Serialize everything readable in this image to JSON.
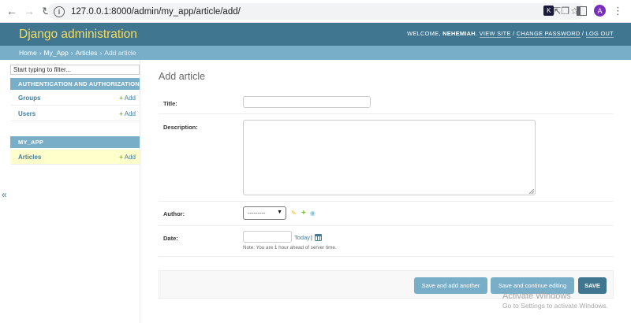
{
  "browser": {
    "url": "127.0.0.1:8000/admin/my_app/article/add/",
    "avatar_letter": "A",
    "ext_letter": "K"
  },
  "header": {
    "brand": "Django administration",
    "welcome": "WELCOME,",
    "username": "NEHEMIAH",
    "view_site": "VIEW SITE",
    "change_password": "CHANGE PASSWORD",
    "log_out": "LOG OUT",
    "separator": "/"
  },
  "breadcrumbs": {
    "items": [
      "Home",
      "My_App",
      "Articles"
    ],
    "current": "Add article",
    "sep": "›"
  },
  "sidebar": {
    "filter_placeholder": "Start typing to filter...",
    "collapse_glyph": "«",
    "apps": [
      {
        "caption": "AUTHENTICATION AND AUTHORIZATION",
        "models": [
          {
            "name": "Groups",
            "add": "Add"
          },
          {
            "name": "Users",
            "add": "Add"
          }
        ]
      },
      {
        "caption": "MY_APP",
        "models": [
          {
            "name": "Articles",
            "add": "Add"
          }
        ]
      }
    ]
  },
  "main": {
    "title": "Add article",
    "fields": {
      "title_label": "Title:",
      "description_label": "Description:",
      "author_label": "Author:",
      "author_selected": "---------",
      "date_label": "Date:",
      "today": "Today",
      "pipe": "|",
      "date_note": "Note: You are 1 hour ahead of server time."
    },
    "buttons": {
      "save_add_another": "Save and add another",
      "save_continue": "Save and continue editing",
      "save": "SAVE"
    }
  },
  "watermark": {
    "line1": "Activate Windows",
    "line2": "Go to Settings to activate Windows."
  },
  "colors": {
    "header_bg": "#417690",
    "brand": "#f5dd5d",
    "breadcrumb_bg": "#79aec8",
    "link": "#447e9b",
    "add_green": "#70bf2b",
    "active_row": "#ffffcc"
  }
}
